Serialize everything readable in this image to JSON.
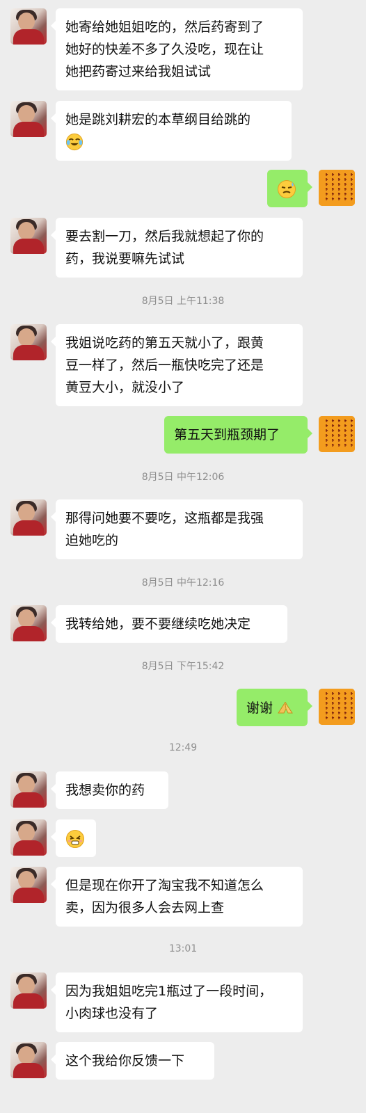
{
  "messages": [
    {
      "side": "left",
      "lines": [
        "她寄给她姐姐吃的，然后药寄到了",
        "她好的快差不多了久没吃，现在让",
        "她把药寄过来给我姐试试"
      ]
    },
    {
      "side": "left",
      "lines": [
        "她是跳刘耕宏的本草纲目给跳的"
      ],
      "emoji": "crying-laughing-emoji"
    },
    {
      "side": "right",
      "lines": [],
      "emoji": "sweat-smile-emoji"
    },
    {
      "side": "left",
      "lines": [
        "要去割一刀，然后我就想起了你的",
        "药，我说要嘛先试试"
      ]
    },
    {
      "type": "time",
      "text": "8月5日 上午11:38"
    },
    {
      "side": "left",
      "lines": [
        "我姐说吃药的第五天就小了，跟黄",
        "豆一样了，然后一瓶快吃完了还是",
        "黄豆大小，就没小了"
      ]
    },
    {
      "side": "right",
      "lines": [
        "第五天到瓶颈期了"
      ]
    },
    {
      "type": "time",
      "text": "8月5日 中午12:06"
    },
    {
      "side": "left",
      "lines": [
        "那得问她要不要吃，这瓶都是我强",
        "迫她吃的"
      ]
    },
    {
      "type": "time",
      "text": "8月5日 中午12:16"
    },
    {
      "side": "left",
      "lines": [
        "我转给她，要不要继续吃她决定"
      ]
    },
    {
      "type": "time",
      "text": "8月5日 下午15:42"
    },
    {
      "side": "right",
      "lines": [
        "谢谢"
      ],
      "emoji": "folded-hands-emoji"
    },
    {
      "type": "time",
      "text": "12:49"
    },
    {
      "side": "left",
      "lines": [
        "我想卖你的药"
      ]
    },
    {
      "side": "left",
      "lines": [],
      "emoji": "grimace-face-emoji"
    },
    {
      "side": "left",
      "lines": [
        "但是现在你开了淘宝我不知道怎么",
        "卖，因为很多人会去网上查"
      ]
    },
    {
      "type": "time",
      "text": "13:01"
    },
    {
      "side": "left",
      "lines": [
        "因为我姐姐吃完1瓶过了一段时间，",
        "小肉球也没有了"
      ]
    },
    {
      "side": "left",
      "lines": [
        "这个我给你反馈一下"
      ]
    }
  ],
  "colors": {
    "background": "#ededed",
    "bubble_left": "#ffffff",
    "bubble_right": "#95ec69",
    "timestamp": "#8e8e8e"
  }
}
